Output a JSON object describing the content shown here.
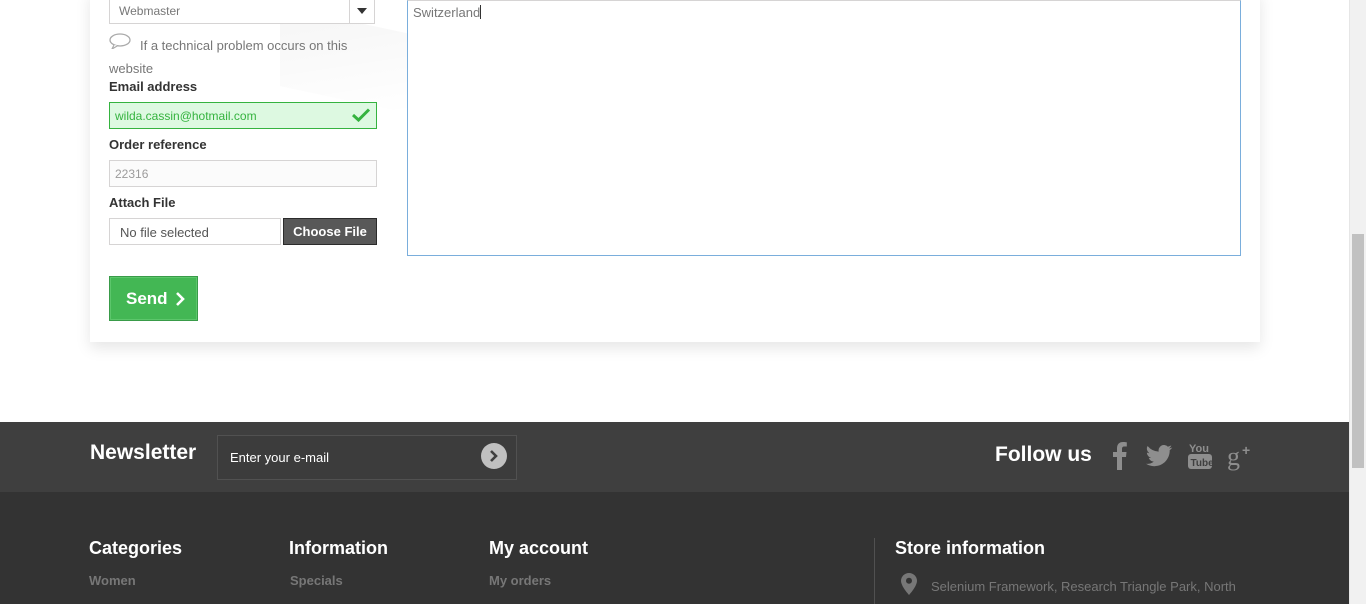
{
  "form": {
    "subject_selected": "Webmaster",
    "subject_hint": "If a technical problem occurs on this website",
    "email_label": "Email address",
    "email_value": "wilda.cassin@hotmail.com",
    "order_label": "Order reference",
    "order_value": "22316",
    "attach_label": "Attach File",
    "file_name": "No file selected",
    "choose_file_label": "Choose File",
    "send_label": "Send",
    "message_value": "Switzerland"
  },
  "newsletter": {
    "title": "Newsletter",
    "placeholder": "Enter your e-mail"
  },
  "follow": {
    "title": "Follow us",
    "icons": [
      "facebook-icon",
      "twitter-icon",
      "youtube-icon",
      "google-plus-icon"
    ]
  },
  "footer": {
    "categories": {
      "title": "Categories",
      "links": [
        "Women"
      ]
    },
    "information": {
      "title": "Information",
      "links": [
        "Specials"
      ]
    },
    "account": {
      "title": "My account",
      "links": [
        "My orders"
      ]
    },
    "store": {
      "title": "Store information",
      "address": "Selenium Framework, Research Triangle Park, North"
    }
  },
  "colors": {
    "success_green": "#35b33f",
    "send_green": "#43b754",
    "footer_dark": "#333333",
    "newsletter_band": "#3f3f3f"
  }
}
